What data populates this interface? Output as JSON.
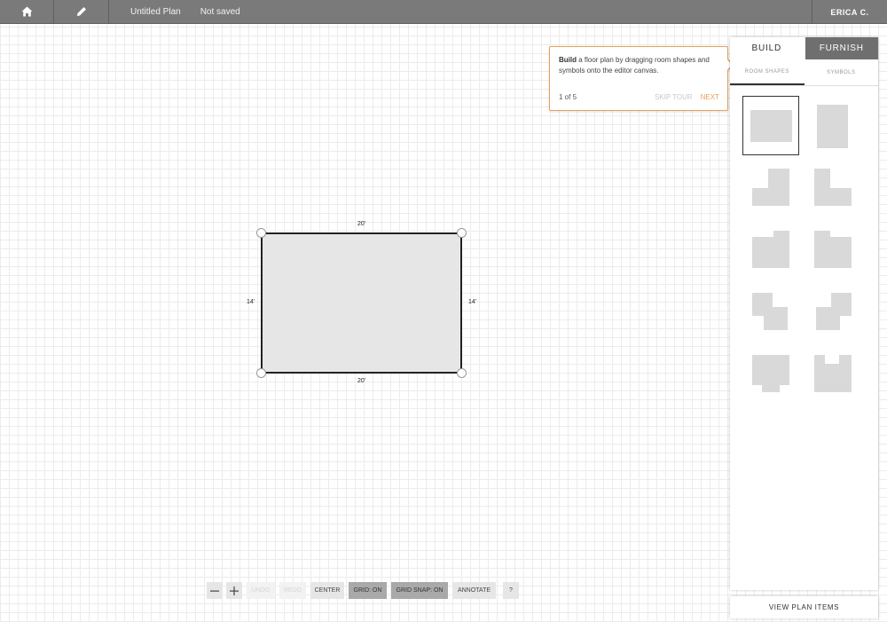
{
  "topbar": {
    "home_icon": "home-icon",
    "edit_icon": "pencil-icon",
    "plan_title": "Untitled Plan",
    "save_status": "Not saved",
    "user_name": "ERICA C."
  },
  "canvas": {
    "room": {
      "top_dim": "20'",
      "bottom_dim": "20'",
      "left_dim": "14'",
      "right_dim": "14'"
    }
  },
  "tour": {
    "text_bold": "Build",
    "text_rest": " a floor plan by dragging room shapes and symbols onto the editor canvas.",
    "step": "1 of 5",
    "skip_label": "SKIP TOUR",
    "next_label": "NEXT",
    "accent_color": "#e9a05a"
  },
  "panel": {
    "tabs": [
      "BUILD",
      "FURNISH"
    ],
    "subtabs": [
      "ROOM SHAPES",
      "SYMBOLS"
    ],
    "shapes": [
      "rectangle-wide",
      "rectangle-tall",
      "l-shape-top-right",
      "l-shape-top-left",
      "notch-top-right",
      "notch-top-left",
      "step-shape-right",
      "step-shape-left",
      "notch-bottom",
      "notch-top-center"
    ],
    "view_items_label": "VIEW PLAN ITEMS"
  },
  "toolbar": {
    "zoom_out_icon": "minus-icon",
    "zoom_in_icon": "plus-icon",
    "undo": "UNDO",
    "redo": "REDO",
    "center": "CENTER",
    "grid": "GRID: ON",
    "grid_snap": "GRID SNAP: ON",
    "annotate": "ANNOTATE",
    "help": "?"
  }
}
